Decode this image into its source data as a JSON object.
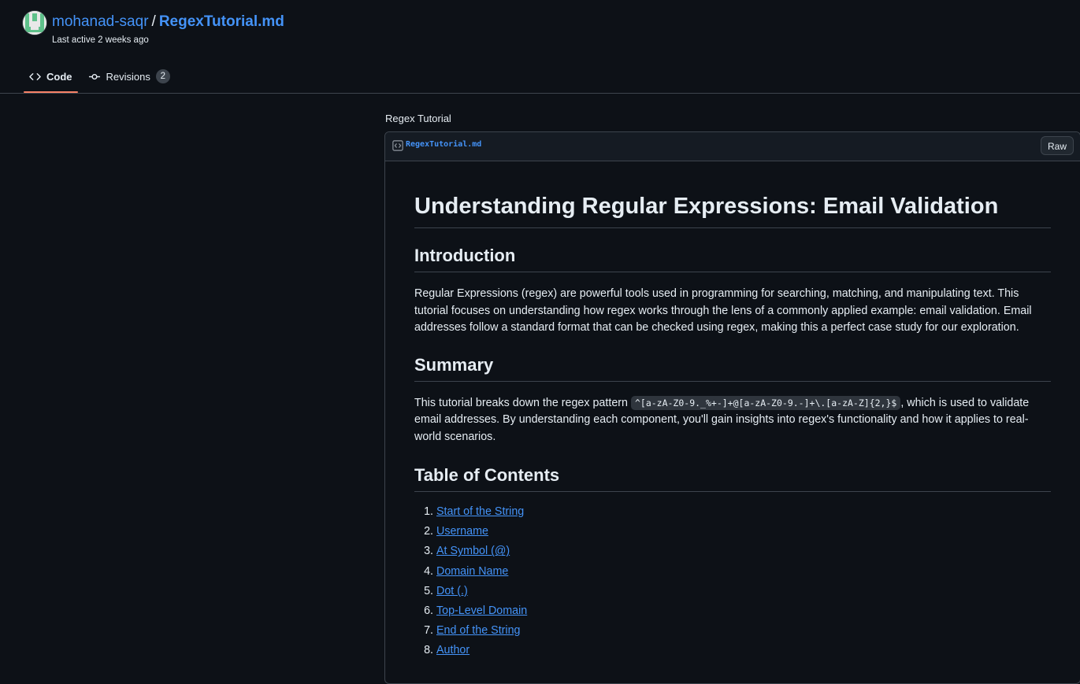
{
  "header": {
    "owner": "mohanad-saqr",
    "separator": "/",
    "file_title": "RegexTutorial.md",
    "last_active": "Last active 2 weeks ago"
  },
  "tabs": [
    {
      "label": "Code",
      "icon": "code-icon",
      "selected": true
    },
    {
      "label": "Revisions",
      "icon": "git-commit-icon",
      "count": "2",
      "selected": false
    }
  ],
  "gist": {
    "description": "Regex Tutorial",
    "filename": "RegexTutorial.md",
    "raw_label": "Raw"
  },
  "content": {
    "title": "Understanding Regular Expressions: Email Validation",
    "intro_heading": "Introduction",
    "intro_text": "Regular Expressions (regex) are powerful tools used in programming for searching, matching, and manipulating text. This tutorial focuses on understanding how regex works through the lens of a commonly applied example: email validation. Email addresses follow a standard format that can be checked using regex, making this a perfect case study for our exploration.",
    "summary_heading": "Summary",
    "summary_before": "This tutorial breaks down the regex pattern ",
    "summary_code": "^[a-zA-Z0-9._%+-]+@[a-zA-Z0-9.-]+\\.[a-zA-Z]{2,}$",
    "summary_after": ", which is used to validate email addresses. By understanding each component, you'll gain insights into regex's functionality and how it applies to real-world scenarios.",
    "toc_heading": "Table of Contents",
    "toc": [
      "Start of the String",
      "Username",
      "At Symbol (@)",
      "Domain Name",
      "Dot (.)",
      "Top-Level Domain",
      "End of the String",
      "Author"
    ]
  },
  "colors": {
    "background": "#0d1117",
    "link": "#4493f8",
    "tab_underline": "#f78166",
    "border": "#3d444d"
  }
}
